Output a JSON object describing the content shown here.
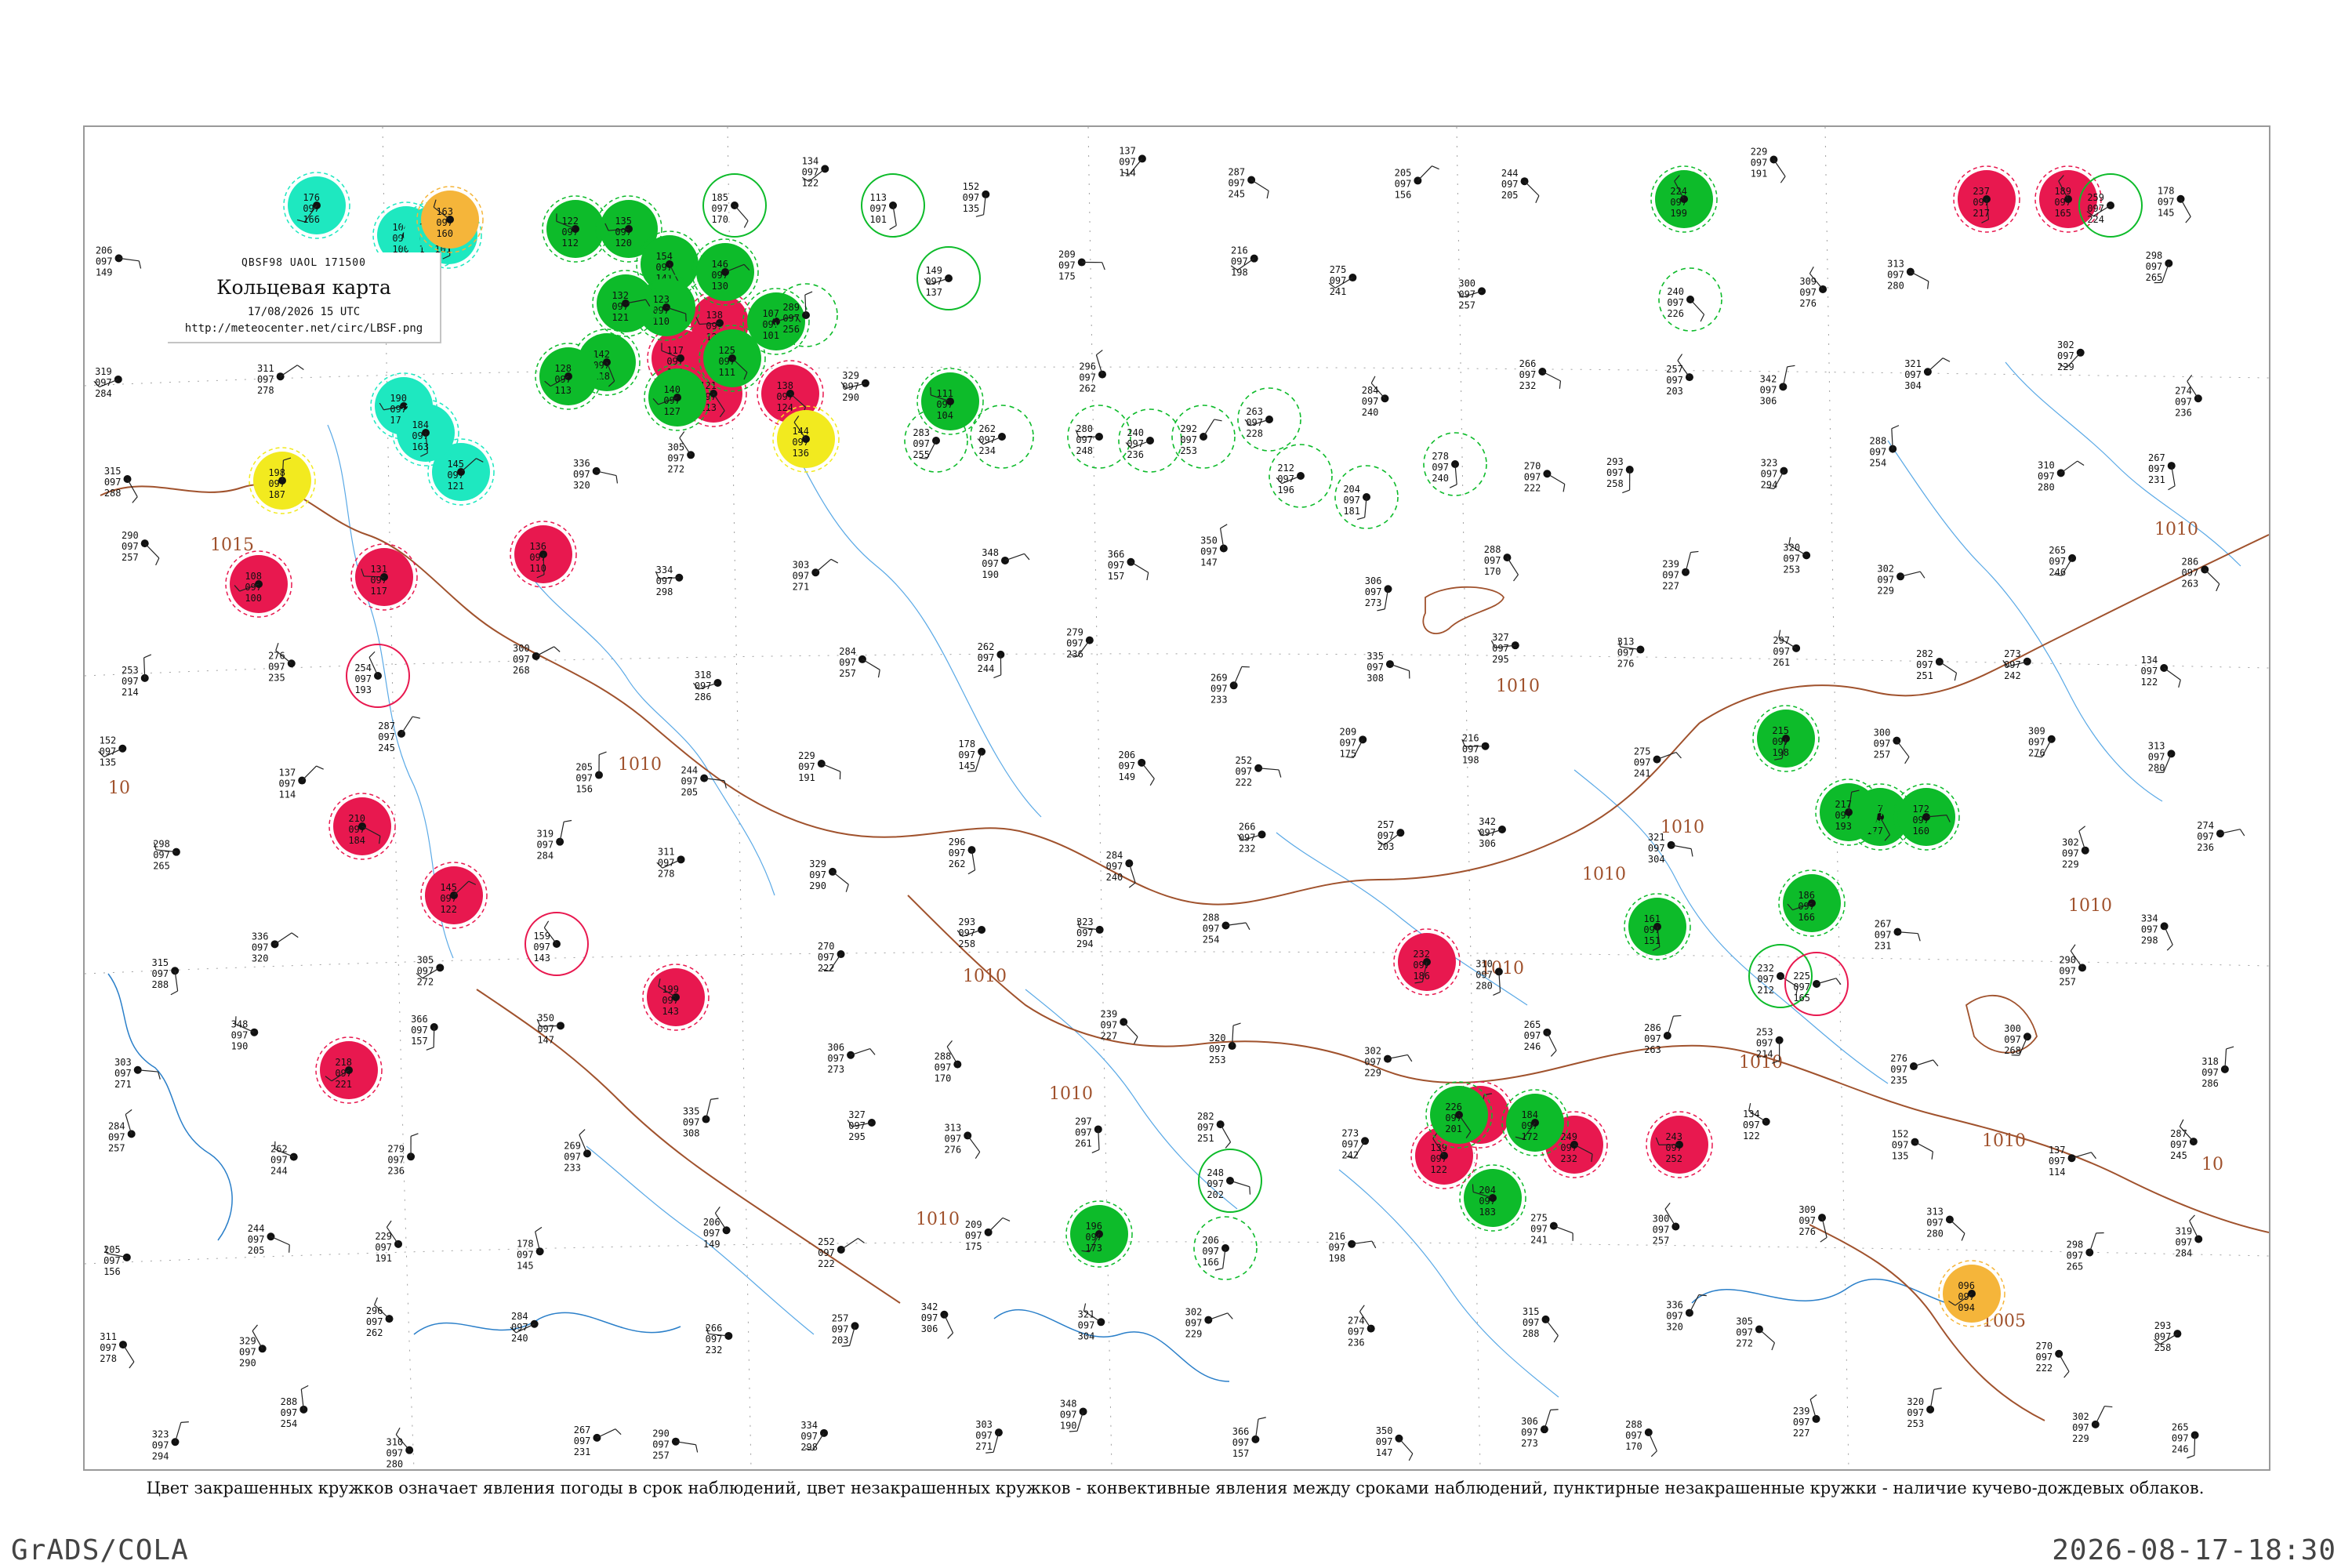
{
  "header": {
    "product_code": "QBSF98  UAOL  171500",
    "title": "Кольцевая карта",
    "date": "17/08/2026 15 UTC",
    "url": "http://meteocenter.net/circ/LBSF.png"
  },
  "legend": {
    "note": "Цвет закрашенных кружков означает явления погоды в срок наблюдений, цвет незакрашенных кружков - конвективные явления между сроками наблюдений, пунктирные незакрашенные кружки - наличие кучево-дождевых облаков."
  },
  "footer": {
    "software": "GrADS/COLA",
    "timestamp": "2026-08-17-18:30"
  },
  "isobars": {
    "labels": [
      "1015",
      "1010",
      "1010",
      "1010",
      "1010",
      "1010",
      "1010",
      "1010",
      "1010",
      "1010",
      "1010",
      "1010",
      "1010",
      "1005",
      "10",
      "10"
    ]
  },
  "colors": {
    "thunderstorm": "#e8184f",
    "rain": "#0dbb2a",
    "shower": "#1ee8c0",
    "fog": "#f5b53a",
    "haze": "#f2ea1f",
    "isobar": "#a0522d",
    "river": "#5aa9e6",
    "coast": "#2a7fc9",
    "grid": "#a0a0a0"
  },
  "stations": {
    "thunderstorm": [
      {
        "t": "138",
        "p": "097",
        "d": "124"
      },
      {
        "t": "117",
        "p": "097",
        "d": "100"
      },
      {
        "t": "138",
        "p": "097",
        "d": "124"
      },
      {
        "t": "136",
        "p": "097",
        "d": "110"
      },
      {
        "t": "108",
        "p": "097",
        "d": "100"
      },
      {
        "t": "131",
        "p": "097",
        "d": "117"
      },
      {
        "t": "210",
        "p": "097",
        "d": "184"
      },
      {
        "t": "145",
        "p": "097",
        "d": "122"
      },
      {
        "t": "199",
        "p": "097",
        "d": "143"
      },
      {
        "t": "218",
        "p": "097",
        "d": "221"
      },
      {
        "t": "232",
        "p": "097",
        "d": "186"
      },
      {
        "t": "156",
        "p": "097",
        "d": "144"
      },
      {
        "t": "139",
        "p": "097",
        "d": "122"
      },
      {
        "t": "249",
        "p": "097",
        "d": "232"
      },
      {
        "t": "243",
        "p": "097",
        "d": "252"
      },
      {
        "t": "237",
        "p": "097",
        "d": "217"
      },
      {
        "t": "189",
        "p": "097",
        "d": "165"
      },
      {
        "t": "121",
        "p": "097",
        "d": "113"
      }
    ],
    "rain": [
      {
        "t": "122",
        "p": "097",
        "d": "112"
      },
      {
        "t": "135",
        "p": "097",
        "d": "120"
      },
      {
        "t": "154",
        "p": "097",
        "d": "141"
      },
      {
        "t": "123",
        "p": "097",
        "d": "110"
      },
      {
        "t": "146",
        "p": "097",
        "d": "130"
      },
      {
        "t": "132",
        "p": "097",
        "d": "121"
      },
      {
        "t": "125",
        "p": "097",
        "d": "111"
      },
      {
        "t": "140",
        "p": "097",
        "d": "127"
      },
      {
        "t": "107",
        "p": "097",
        "d": "101"
      },
      {
        "t": "142",
        "p": "097",
        "d": "118"
      },
      {
        "t": "128",
        "p": "097",
        "d": "113"
      },
      {
        "t": "111",
        "p": "097",
        "d": "104"
      },
      {
        "t": "224",
        "p": "097",
        "d": "199"
      },
      {
        "t": "215",
        "p": "097",
        "d": "198"
      },
      {
        "t": "197",
        "p": "097",
        "d": "177"
      },
      {
        "t": "172",
        "p": "097",
        "d": "160"
      },
      {
        "t": "186",
        "p": "097",
        "d": "166"
      },
      {
        "t": "161",
        "p": "097",
        "d": "151"
      },
      {
        "t": "204",
        "p": "097",
        "d": "183"
      },
      {
        "t": "196",
        "p": "097",
        "d": "173"
      },
      {
        "t": "226",
        "p": "097",
        "d": "201"
      },
      {
        "t": "217",
        "p": "097",
        "d": "193"
      },
      {
        "t": "184",
        "p": "097",
        "d": "172"
      }
    ],
    "shower": [
      {
        "t": "176",
        "p": "097",
        "d": "166"
      },
      {
        "t": "104",
        "p": "097",
        "d": "100"
      },
      {
        "t": "160",
        "p": "097",
        "d": "150"
      },
      {
        "t": "106",
        "p": "097",
        "d": "101"
      },
      {
        "t": "145",
        "p": "097",
        "d": "121"
      },
      {
        "t": "190",
        "p": "097",
        "d": "172"
      },
      {
        "t": "184",
        "p": "097",
        "d": "163"
      }
    ],
    "fog": [
      {
        "t": "163",
        "p": "097",
        "d": "160"
      },
      {
        "t": "096",
        "p": "097",
        "d": "094"
      }
    ],
    "haze": [
      {
        "t": "198",
        "p": "097",
        "d": "187"
      },
      {
        "t": "144",
        "p": "097",
        "d": "136"
      }
    ],
    "open_rain": [
      {
        "t": "185",
        "p": "097",
        "d": "170"
      },
      {
        "t": "113",
        "p": "097",
        "d": "101"
      },
      {
        "t": "149",
        "p": "097",
        "d": "137"
      },
      {
        "t": "232",
        "p": "097",
        "d": "212"
      },
      {
        "t": "248",
        "p": "097",
        "d": "202"
      },
      {
        "t": "259",
        "p": "097",
        "d": "224"
      }
    ],
    "open_storm": [
      {
        "t": "254",
        "p": "097",
        "d": "193"
      },
      {
        "t": "159",
        "p": "097",
        "d": "143"
      },
      {
        "t": "225",
        "p": "097",
        "d": "165"
      }
    ],
    "dashed_cb": [
      {
        "t": "283",
        "p": "097",
        "d": "255"
      },
      {
        "t": "262",
        "p": "097",
        "d": "234"
      },
      {
        "t": "280",
        "p": "097",
        "d": "248"
      },
      {
        "t": "240",
        "p": "097",
        "d": "236"
      },
      {
        "t": "292",
        "p": "097",
        "d": "253"
      },
      {
        "t": "263",
        "p": "097",
        "d": "228"
      },
      {
        "t": "212",
        "p": "097",
        "d": "196"
      },
      {
        "t": "204",
        "p": "097",
        "d": "181"
      },
      {
        "t": "278",
        "p": "097",
        "d": "240"
      },
      {
        "t": "289",
        "p": "097",
        "d": "256"
      },
      {
        "t": "240",
        "p": "097",
        "d": "226"
      },
      {
        "t": "206",
        "p": "097",
        "d": "166"
      }
    ],
    "plain": [
      {
        "t": "134",
        "p": "097",
        "d": "122"
      },
      {
        "t": "152",
        "p": "097",
        "d": "135"
      },
      {
        "t": "137",
        "p": "097",
        "d": "114"
      },
      {
        "t": "287",
        "p": "097",
        "d": "245"
      },
      {
        "t": "205",
        "p": "097",
        "d": "156"
      },
      {
        "t": "244",
        "p": "097",
        "d": "205"
      },
      {
        "t": "229",
        "p": "097",
        "d": "191"
      },
      {
        "t": "178",
        "p": "097",
        "d": "145"
      },
      {
        "t": "206",
        "p": "097",
        "d": "149"
      },
      {
        "t": "252",
        "p": "097",
        "d": "222"
      },
      {
        "t": "209",
        "p": "097",
        "d": "175"
      },
      {
        "t": "216",
        "p": "097",
        "d": "198"
      },
      {
        "t": "275",
        "p": "097",
        "d": "241"
      },
      {
        "t": "300",
        "p": "097",
        "d": "257"
      },
      {
        "t": "309",
        "p": "097",
        "d": "276"
      },
      {
        "t": "313",
        "p": "097",
        "d": "280"
      },
      {
        "t": "298",
        "p": "097",
        "d": "265"
      },
      {
        "t": "319",
        "p": "097",
        "d": "284"
      },
      {
        "t": "311",
        "p": "097",
        "d": "278"
      },
      {
        "t": "329",
        "p": "097",
        "d": "290"
      },
      {
        "t": "296",
        "p": "097",
        "d": "262"
      },
      {
        "t": "284",
        "p": "097",
        "d": "240"
      },
      {
        "t": "266",
        "p": "097",
        "d": "232"
      },
      {
        "t": "257",
        "p": "097",
        "d": "203"
      },
      {
        "t": "342",
        "p": "097",
        "d": "306"
      },
      {
        "t": "321",
        "p": "097",
        "d": "304"
      },
      {
        "t": "302",
        "p": "097",
        "d": "229"
      },
      {
        "t": "274",
        "p": "097",
        "d": "236"
      },
      {
        "t": "315",
        "p": "097",
        "d": "288"
      },
      {
        "t": "336",
        "p": "097",
        "d": "320"
      },
      {
        "t": "305",
        "p": "097",
        "d": "272"
      },
      {
        "t": "270",
        "p": "097",
        "d": "222"
      },
      {
        "t": "293",
        "p": "097",
        "d": "258"
      },
      {
        "t": "323",
        "p": "097",
        "d": "294"
      },
      {
        "t": "288",
        "p": "097",
        "d": "254"
      },
      {
        "t": "310",
        "p": "097",
        "d": "280"
      },
      {
        "t": "267",
        "p": "097",
        "d": "231"
      },
      {
        "t": "290",
        "p": "097",
        "d": "257"
      },
      {
        "t": "334",
        "p": "097",
        "d": "298"
      },
      {
        "t": "303",
        "p": "097",
        "d": "271"
      },
      {
        "t": "348",
        "p": "097",
        "d": "190"
      },
      {
        "t": "366",
        "p": "097",
        "d": "157"
      },
      {
        "t": "350",
        "p": "097",
        "d": "147"
      },
      {
        "t": "306",
        "p": "097",
        "d": "273"
      },
      {
        "t": "288",
        "p": "097",
        "d": "170"
      },
      {
        "t": "239",
        "p": "097",
        "d": "227"
      },
      {
        "t": "320",
        "p": "097",
        "d": "253"
      },
      {
        "t": "302",
        "p": "097",
        "d": "229"
      },
      {
        "t": "265",
        "p": "097",
        "d": "246"
      },
      {
        "t": "286",
        "p": "097",
        "d": "263"
      },
      {
        "t": "253",
        "p": "097",
        "d": "214"
      },
      {
        "t": "276",
        "p": "097",
        "d": "235"
      },
      {
        "t": "300",
        "p": "097",
        "d": "268"
      },
      {
        "t": "318",
        "p": "097",
        "d": "286"
      },
      {
        "t": "284",
        "p": "097",
        "d": "257"
      },
      {
        "t": "262",
        "p": "097",
        "d": "244"
      },
      {
        "t": "279",
        "p": "097",
        "d": "236"
      },
      {
        "t": "269",
        "p": "097",
        "d": "233"
      },
      {
        "t": "335",
        "p": "097",
        "d": "308"
      },
      {
        "t": "327",
        "p": "097",
        "d": "295"
      },
      {
        "t": "313",
        "p": "097",
        "d": "276"
      },
      {
        "t": "297",
        "p": "097",
        "d": "261"
      },
      {
        "t": "282",
        "p": "097",
        "d": "251"
      },
      {
        "t": "273",
        "p": "097",
        "d": "242"
      }
    ]
  }
}
